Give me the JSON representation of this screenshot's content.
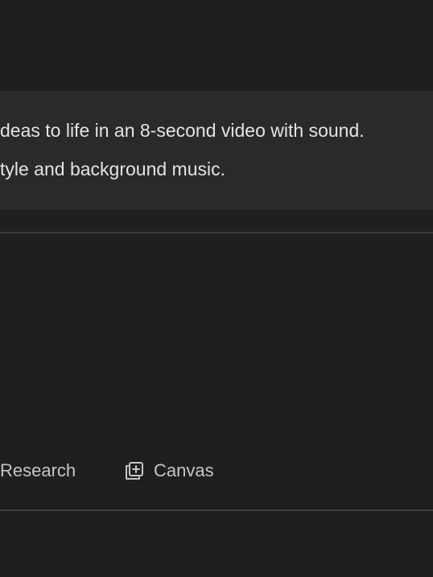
{
  "info": {
    "line1": "deas to life in an 8-second video with sound.",
    "line2": "tyle and background music."
  },
  "toolbar": {
    "research_label": "Research",
    "canvas_label": "Canvas",
    "canvas_icon": "canvas-icon"
  },
  "colors": {
    "background": "#1e1f20",
    "info_box": "#282a2c",
    "text": "#e3e3e3",
    "tool_text": "#c4c7c5",
    "divider": "#3c3d3f"
  }
}
